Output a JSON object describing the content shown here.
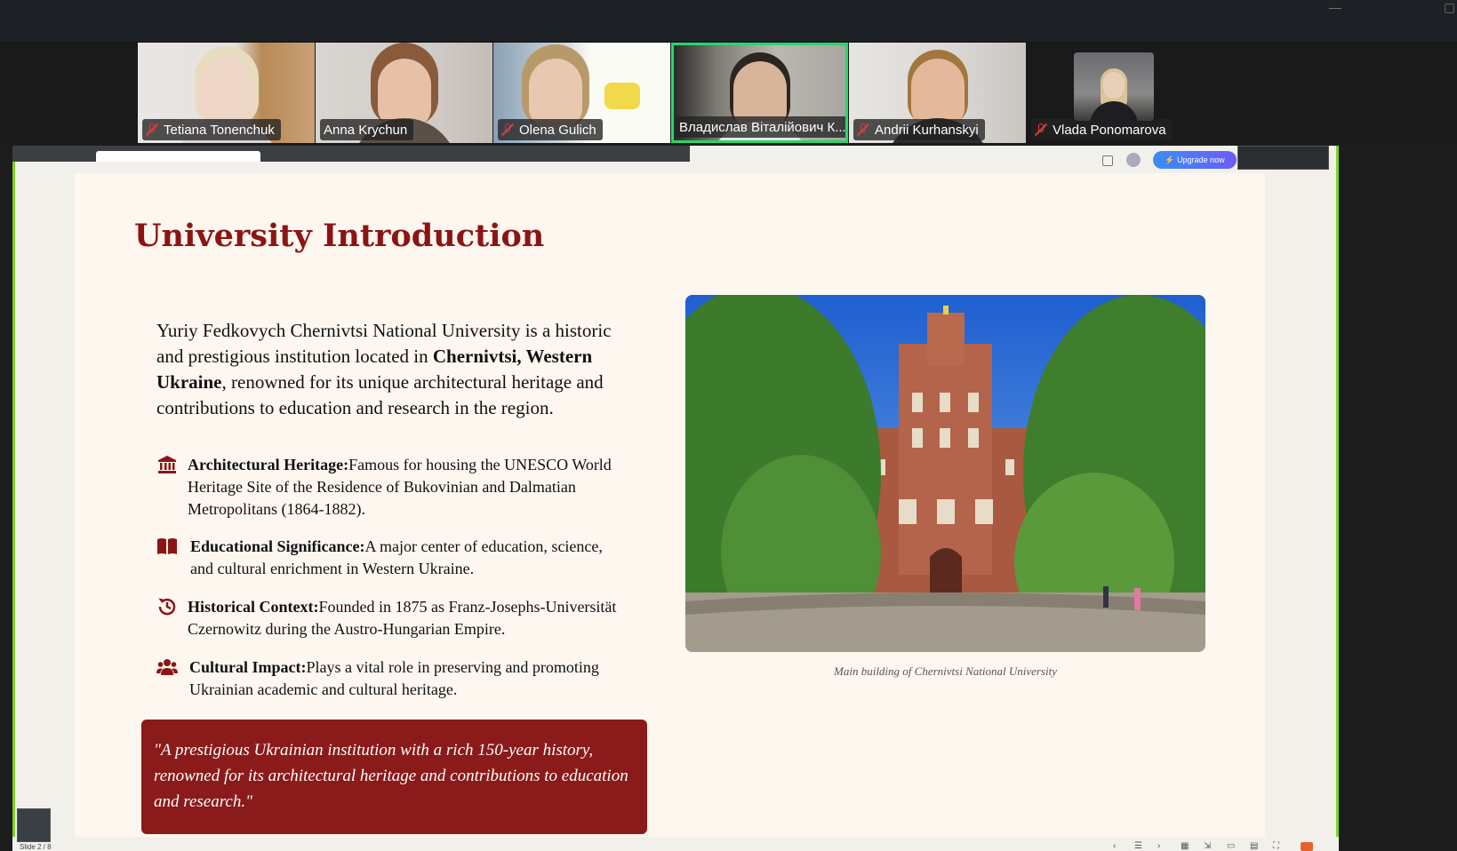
{
  "window": {
    "minimize_glyph": "—",
    "maximize_glyph": "▢"
  },
  "participants": [
    {
      "name": "Tetiana Tonenchuk",
      "muted": true
    },
    {
      "name": "Anna Krychun",
      "muted": false
    },
    {
      "name": "Olena Gulich",
      "muted": true
    },
    {
      "name": "Владислав Віталійович К...",
      "muted": false,
      "active_speaker": true
    },
    {
      "name": "Andrii Kurhanskyi",
      "muted": true
    },
    {
      "name": "Vlada Ponomarova",
      "muted": true
    }
  ],
  "browser": {
    "upgrade_label": "⚡ Upgrade now"
  },
  "slide": {
    "title": "University Introduction",
    "intro_parts": [
      "Yuriy Fedkovych Chernivtsi National University is a historic and prestigious institution located in ",
      "Chernivtsi, Western Ukraine",
      ", renowned for its unique architectural heritage and contributions to education and research in the region."
    ],
    "bullets": [
      {
        "icon": "landmark-icon",
        "heading": "Architectural Heritage:",
        "text": "Famous for housing the UNESCO World Heritage Site of the Residence of Bukovinian and Dalmatian Metropolitans (1864-1882)."
      },
      {
        "icon": "book-open-icon",
        "heading": "Educational Significance:",
        "text": "A major center of education, science, and cultural enrichment in Western Ukraine."
      },
      {
        "icon": "history-icon",
        "heading": "Historical Context:",
        "text": "Founded in 1875 as Franz-Josephs-Universität Czernowitz during the Austro-Hungarian Empire."
      },
      {
        "icon": "users-icon",
        "heading": "Cultural Impact:",
        "text": "Plays a vital role in preserving and promoting Ukrainian academic and cultural heritage."
      }
    ],
    "quote": "\"A prestigious Ukrainian institution with a rich 150-year history, renowned for its architectural heritage and contributions to education and research.\"",
    "image_caption": "Main building of Chernivtsi National University"
  },
  "footer": {
    "slide_counter": "Slide 2 / 8"
  },
  "colors": {
    "accent": "#8b1515",
    "quote_bg": "#8b1a1a",
    "active_speaker_border": "#23d96b",
    "muted_icon": "#e23a3a",
    "share_border": "#7ed321"
  }
}
